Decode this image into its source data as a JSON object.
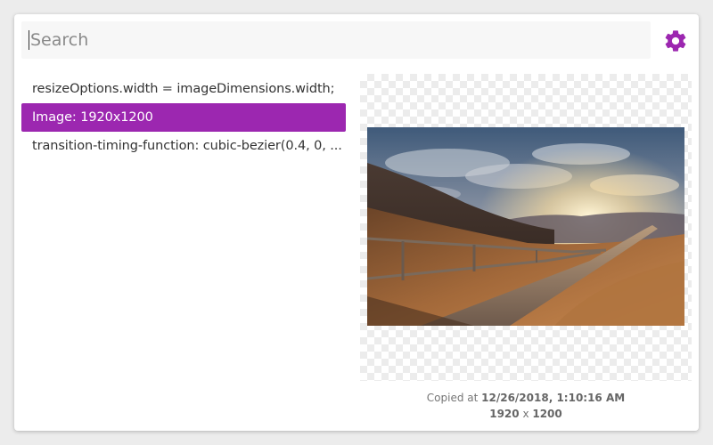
{
  "search": {
    "placeholder": "Search",
    "value": ""
  },
  "settings": {
    "icon": "gear-icon",
    "color": "#9c27b0"
  },
  "clipboard": {
    "items": [
      {
        "label": "resizeOptions.width = imageDimensions.width;",
        "selected": false
      },
      {
        "label": "Image: 1920x1200",
        "selected": true
      },
      {
        "label": "transition-timing-function: cubic-bezier(0.4, 0, ...",
        "selected": false
      }
    ]
  },
  "preview": {
    "copied_prefix": "Copied at ",
    "copied_at": "12/26/2018, 1:10:16 AM",
    "width": "1920",
    "times": " x ",
    "height": "1200"
  },
  "colors": {
    "accent": "#9c27b0",
    "selected_text": "#ffffff"
  }
}
